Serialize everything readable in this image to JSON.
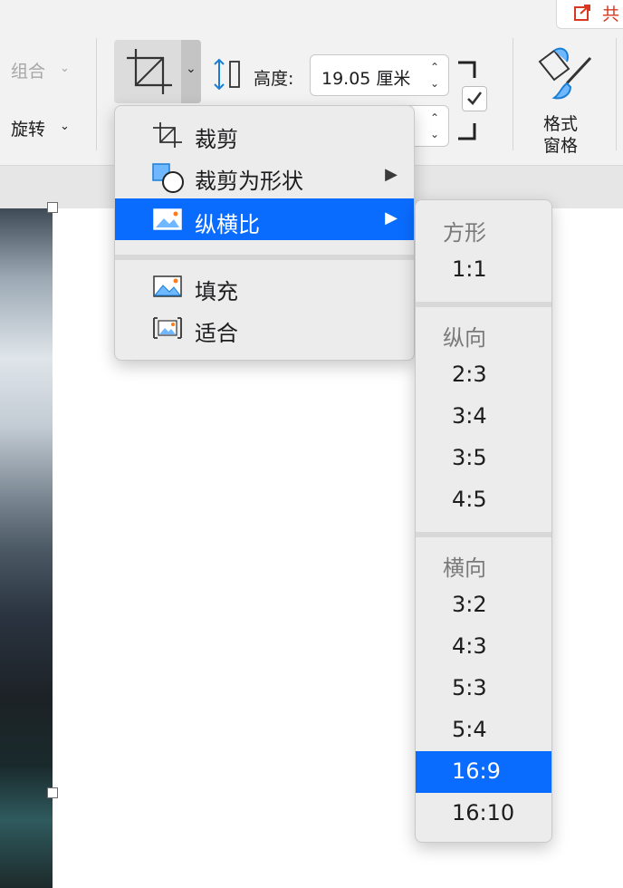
{
  "ribbon": {
    "group_label": "组合",
    "rotate_label": "旋转",
    "height_label": "高度:",
    "height_value": "19.05 厘米",
    "format_pane_line1": "格式",
    "format_pane_line2": "窗格",
    "share_label": "共"
  },
  "crop_menu": {
    "items": [
      {
        "label": "裁剪",
        "icon": "crop-icon"
      },
      {
        "label": "裁剪为形状",
        "icon": "crop-to-shape-icon",
        "has_submenu": true
      },
      {
        "label": "纵横比",
        "icon": "aspect-ratio-icon",
        "has_submenu": true,
        "active": true
      },
      {
        "label": "填充",
        "icon": "fill-icon"
      },
      {
        "label": "适合",
        "icon": "fit-icon"
      }
    ]
  },
  "aspect_submenu": {
    "square_header": "方形",
    "square": [
      "1:1"
    ],
    "portrait_header": "纵向",
    "portrait": [
      "2:3",
      "3:4",
      "3:5",
      "4:5"
    ],
    "landscape_header": "横向",
    "landscape": [
      "3:2",
      "4:3",
      "5:3",
      "5:4",
      "16:9",
      "16:10"
    ],
    "selected": "16:9"
  },
  "colors": {
    "accent": "#0a6cff",
    "menu_bg": "#ececec",
    "ribbon_bg": "#f2f2f2"
  }
}
